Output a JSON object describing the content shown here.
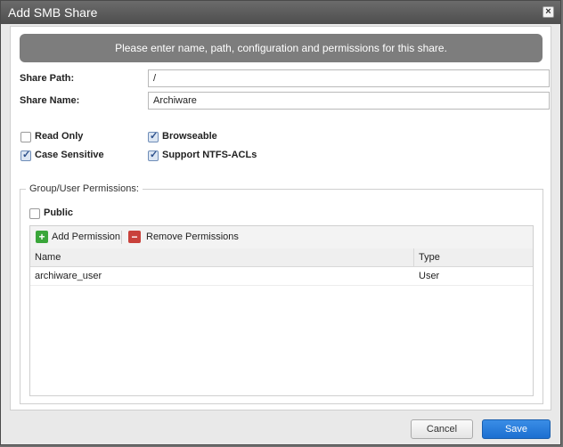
{
  "dialog": {
    "title": "Add SMB Share",
    "close_glyph": "×",
    "banner": "Please enter name, path, configuration and permissions for this share."
  },
  "form": {
    "share_path_label": "Share Path:",
    "share_path_value": "/",
    "share_name_label": "Share Name:",
    "share_name_value": "Archiware"
  },
  "options": [
    {
      "label": "Read Only",
      "checked": false
    },
    {
      "label": "Browseable",
      "checked": true
    },
    {
      "label": "Case Sensitive",
      "checked": true
    },
    {
      "label": "Support NTFS-ACLs",
      "checked": true
    }
  ],
  "permissions": {
    "legend": "Group/User Permissions:",
    "public_label": "Public",
    "public_checked": false,
    "add_label": "Add Permission",
    "remove_label": "Remove Permissions",
    "columns": {
      "name": "Name",
      "type": "Type"
    },
    "rows": [
      {
        "name": "archiware_user",
        "type": "User"
      }
    ]
  },
  "footer": {
    "cancel_label": "Cancel",
    "save_label": "Save"
  },
  "colors": {
    "add_icon": "#3aa63a",
    "remove_icon": "#c9413b",
    "save_button": "#1c6fd0"
  },
  "icons": [
    "close-icon",
    "checkbox-icon",
    "plus-icon",
    "minus-icon"
  ]
}
